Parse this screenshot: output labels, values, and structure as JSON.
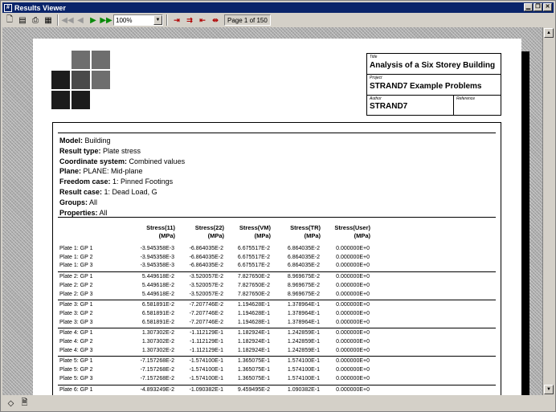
{
  "window": {
    "title": "Results Viewer"
  },
  "toolbar": {
    "zoom": "100%",
    "page_info": "Page 1 of 150"
  },
  "titleblock": {
    "title_label": "Title",
    "title": "Analysis of a Six Storey Building",
    "project_label": "Project",
    "project": "STRAND7 Example Problems",
    "author_label": "Author",
    "author": "STRAND7",
    "reference_label": "Reference"
  },
  "meta": [
    {
      "label": "Model:",
      "value": "Building"
    },
    {
      "label": "Result type:",
      "value": "Plate stress"
    },
    {
      "label": "Coordinate system:",
      "value": "Combined values"
    },
    {
      "label": "Plane:",
      "value": "PLANE: Mid-plane"
    },
    {
      "label": "Freedom case:",
      "value": "1: Pinned Footings"
    },
    {
      "label": "Result case:",
      "value": "1: Dead Load, G"
    },
    {
      "label": "Groups:",
      "value": "All"
    },
    {
      "label": "Properties:",
      "value": "All"
    }
  ],
  "columns": [
    {
      "name": "Stress(11)",
      "unit": "(MPa)"
    },
    {
      "name": "Stress(22)",
      "unit": "(MPa)"
    },
    {
      "name": "Stress(VM)",
      "unit": "(MPa)"
    },
    {
      "name": "Stress(TR)",
      "unit": "(MPa)"
    },
    {
      "name": "Stress(User)",
      "unit": "(MPa)"
    }
  ],
  "rows": [
    [
      "Plate 1: GP 1",
      "-3.945358E-3",
      "-6.864035E-2",
      "6.675517E-2",
      "6.864035E-2",
      "0.000000E+0"
    ],
    [
      "Plate 1: GP 2",
      "-3.945358E-3",
      "-6.864035E-2",
      "6.675517E-2",
      "6.864035E-2",
      "0.000000E+0"
    ],
    [
      "Plate 1: GP 3",
      "-3.945358E-3",
      "-6.864035E-2",
      "6.675517E-2",
      "6.864035E-2",
      "0.000000E+0"
    ],
    [
      "Plate 2: GP 1",
      "5.449618E-2",
      "-3.520057E-2",
      "7.827650E-2",
      "8.969675E-2",
      "0.000000E+0"
    ],
    [
      "Plate 2: GP 2",
      "5.449618E-2",
      "-3.520057E-2",
      "7.827650E-2",
      "8.969675E-2",
      "0.000000E+0"
    ],
    [
      "Plate 2: GP 3",
      "5.449618E-2",
      "-3.520057E-2",
      "7.827650E-2",
      "8.969675E-2",
      "0.000000E+0"
    ],
    [
      "Plate 3: GP 1",
      "6.581891E-2",
      "-7.207746E-2",
      "1.194628E-1",
      "1.378964E-1",
      "0.000000E+0"
    ],
    [
      "Plate 3: GP 2",
      "6.581891E-2",
      "-7.207746E-2",
      "1.194628E-1",
      "1.378964E-1",
      "0.000000E+0"
    ],
    [
      "Plate 3: GP 3",
      "6.581891E-2",
      "-7.207746E-2",
      "1.194628E-1",
      "1.378964E-1",
      "0.000000E+0"
    ],
    [
      "Plate 4: GP 1",
      "1.307302E-2",
      "-1.112129E-1",
      "1.182924E-1",
      "1.242859E-1",
      "0.000000E+0"
    ],
    [
      "Plate 4: GP 2",
      "1.307302E-2",
      "-1.112129E-1",
      "1.182924E-1",
      "1.242859E-1",
      "0.000000E+0"
    ],
    [
      "Plate 4: GP 3",
      "1.307302E-2",
      "-1.112129E-1",
      "1.182924E-1",
      "1.242859E-1",
      "0.000000E+0"
    ],
    [
      "Plate 5: GP 1",
      "-7.157268E-2",
      "-1.574100E-1",
      "1.365075E-1",
      "1.574100E-1",
      "0.000000E+0"
    ],
    [
      "Plate 5: GP 2",
      "-7.157268E-2",
      "-1.574100E-1",
      "1.365075E-1",
      "1.574100E-1",
      "0.000000E+0"
    ],
    [
      "Plate 5: GP 3",
      "-7.157268E-2",
      "-1.574100E-1",
      "1.365075E-1",
      "1.574100E-1",
      "0.000000E+0"
    ],
    [
      "Plate 6: GP 1",
      "-4.893249E-2",
      "-1.090382E-1",
      "9.459495E-2",
      "1.090382E-1",
      "0.000000E+0"
    ]
  ],
  "colors": {
    "titlebar": "#0a246a",
    "logo_dark": "#1c1c1c",
    "logo_mid": "#4a4a4a",
    "logo_light": "#6e6e6e"
  }
}
